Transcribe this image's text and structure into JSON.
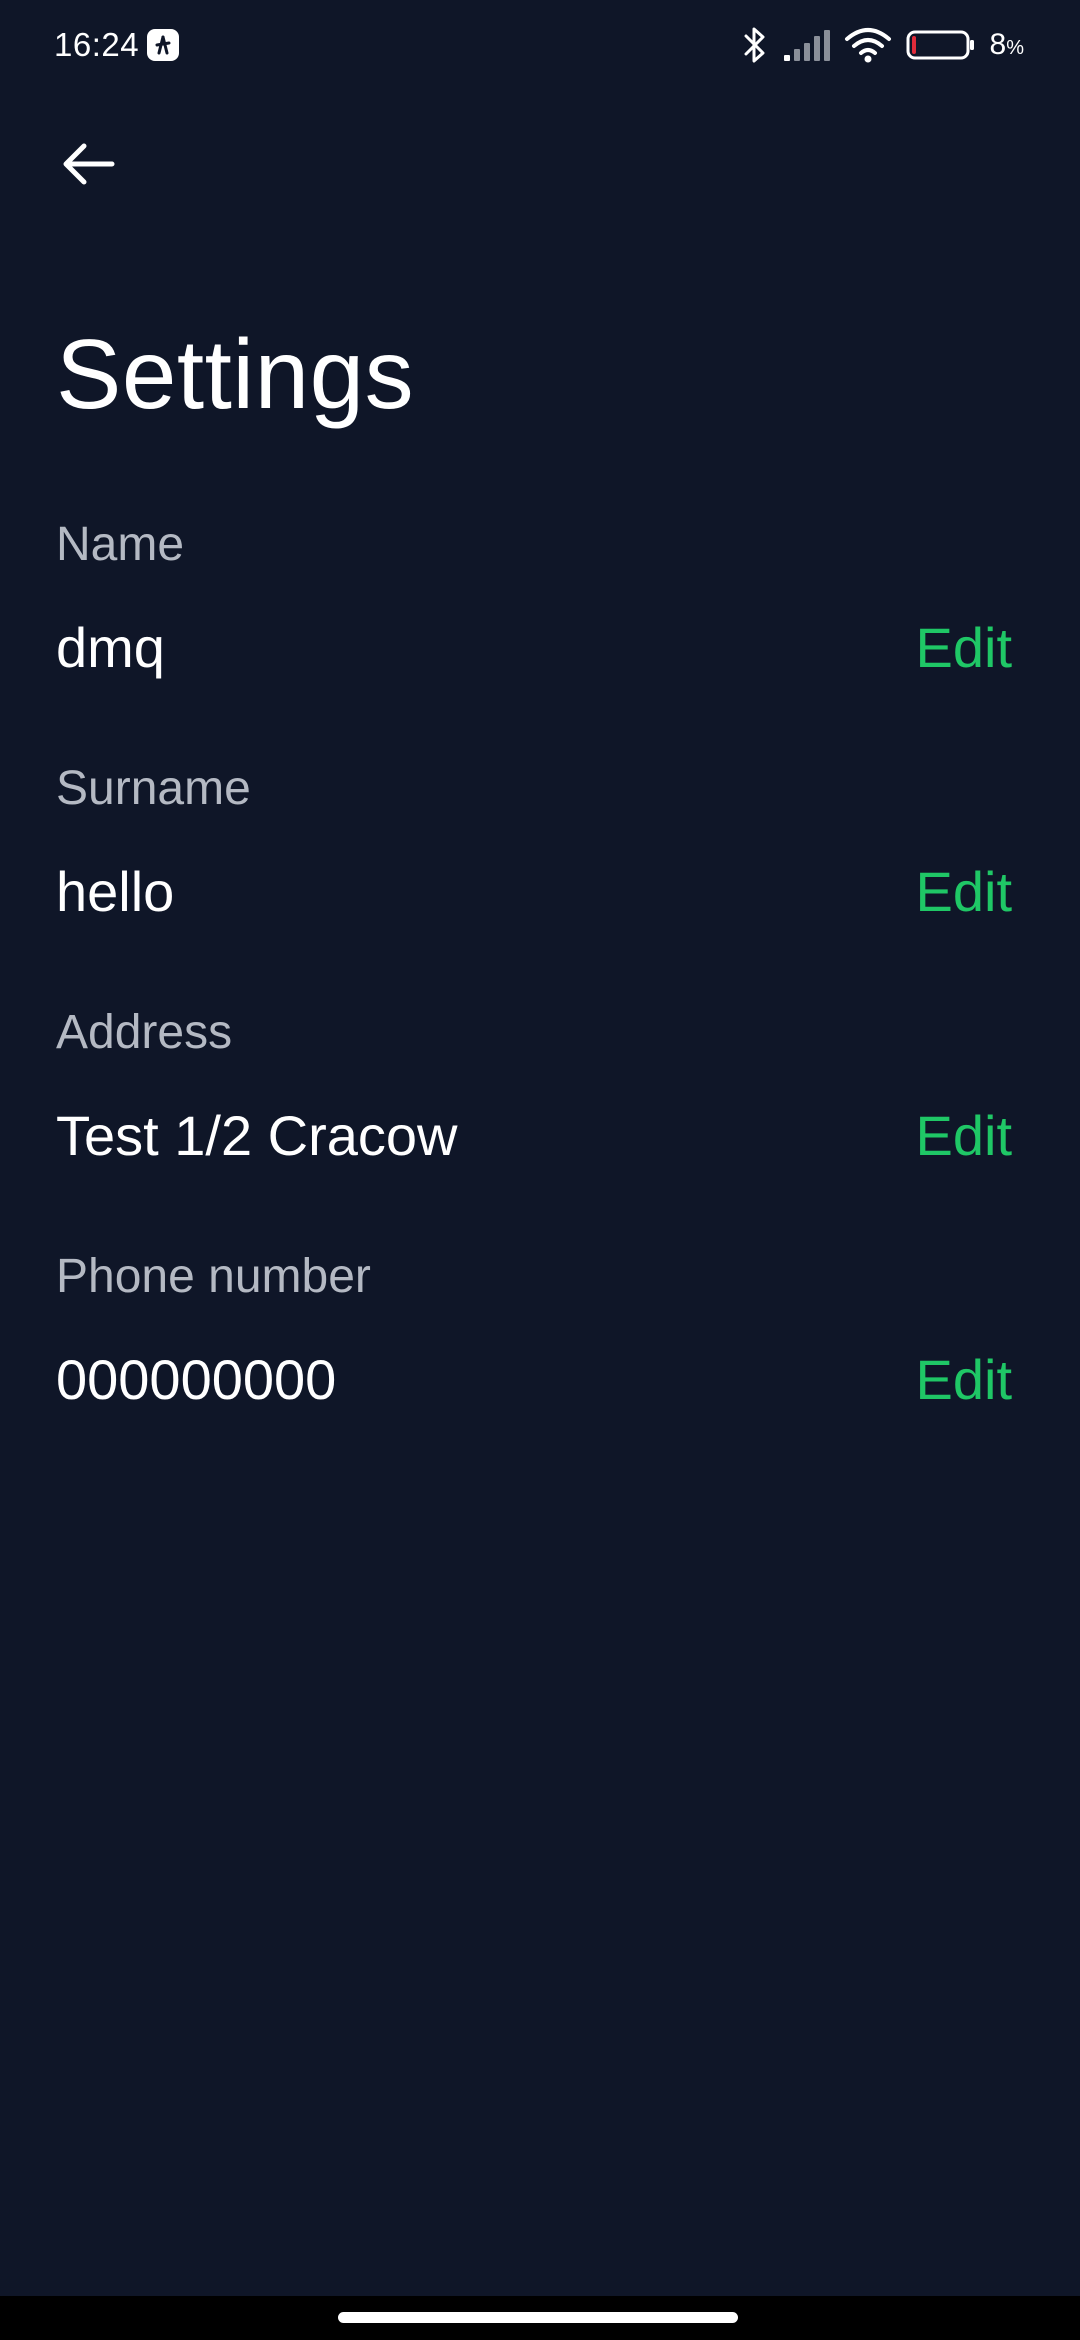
{
  "status_bar": {
    "time": "16:24",
    "battery_percent": "8",
    "battery_unit": "%",
    "icons": [
      "app-notification-icon",
      "bluetooth-icon",
      "signal-icon",
      "wifi-icon",
      "battery-icon"
    ],
    "battery_level": 0.08,
    "battery_color": "#e02b3a"
  },
  "header": {
    "back_icon": "arrow-left-icon",
    "title": "Settings"
  },
  "fields": [
    {
      "label": "Name",
      "value": "dmq",
      "action": "Edit"
    },
    {
      "label": "Surname",
      "value": "hello",
      "action": "Edit"
    },
    {
      "label": "Address",
      "value": "Test 1/2 Cracow",
      "action": "Edit"
    },
    {
      "label": "Phone number",
      "value": "000000000",
      "action": "Edit"
    }
  ],
  "colors": {
    "background": "#0f1628",
    "accent": "#1fc766",
    "label": "#b4b9c3",
    "text": "#ffffff"
  }
}
